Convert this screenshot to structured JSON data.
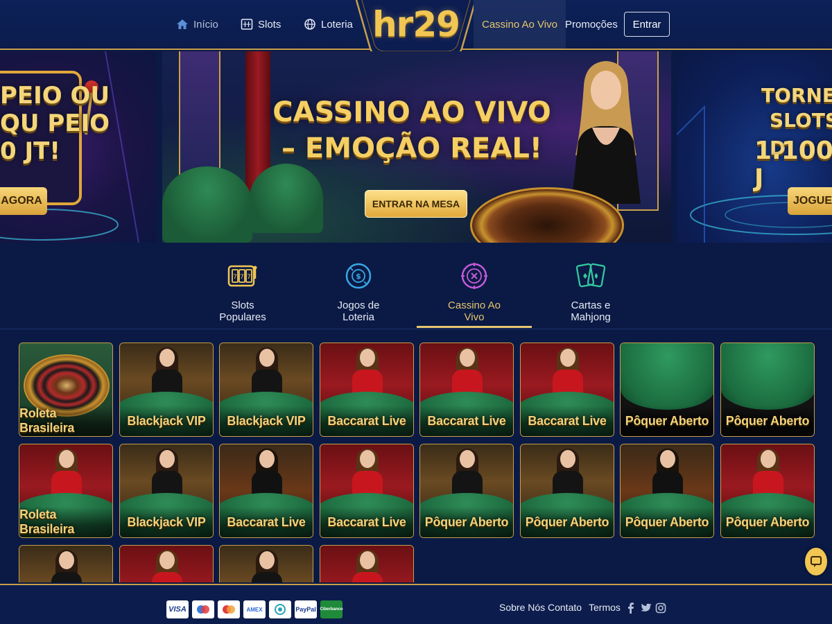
{
  "header": {
    "nav": [
      {
        "label": "Início",
        "icon": "home-icon"
      },
      {
        "label": "Slots",
        "icon": "slot-machine-icon"
      },
      {
        "label": "Loteria",
        "icon": "globe-icon"
      },
      {
        "label": "Cassino Ao Vivo",
        "icon": ""
      },
      {
        "label": "Promoções",
        "icon": ""
      }
    ],
    "logo": "hr29",
    "login_label": "Entrar"
  },
  "hero": {
    "left_slide": {
      "title_lines": [
        "PEIO OU",
        "QU PEIO",
        "0 JT!"
      ],
      "button": "AGORA"
    },
    "main_slide": {
      "title": "CASSINO AO VIVO – EMOÇÃO REAL!",
      "button": "ENTRAR NA MESA"
    },
    "right_slide": {
      "title_lines": [
        "TORNEIO",
        "SLOTS D",
        "1.100 J"
      ],
      "button": "JOGUE"
    },
    "active_dot": 0,
    "dot_count": 5
  },
  "categories": [
    {
      "label": "Slots Populares",
      "icon": "slot-reels-icon",
      "color": "#f1c653"
    },
    {
      "label": "Jogos de Loteria",
      "icon": "lottery-ball-icon",
      "color": "#3aa8e6"
    },
    {
      "label": "Cassino Ao Vivo",
      "icon": "roulette-chip-icon",
      "color": "#c45bd6",
      "active": true
    },
    {
      "label": "Cartas e Mahjong",
      "icon": "playing-cards-icon",
      "color": "#35c8a0"
    }
  ],
  "games": [
    {
      "name": "Roleta Brasileira",
      "kind": "roulette"
    },
    {
      "name": "Blackjack VIP",
      "kind": "blackjack"
    },
    {
      "name": "Blackjack VIP",
      "kind": "blackjack"
    },
    {
      "name": "Baccarat Live",
      "kind": "baccarat"
    },
    {
      "name": "Baccarat Live",
      "kind": "baccarat"
    },
    {
      "name": "Baccarat Live",
      "kind": "baccarat"
    },
    {
      "name": "Pôquer Aberto",
      "kind": "poker"
    },
    {
      "name": "Pôquer Aberto",
      "kind": "poker"
    },
    {
      "name": "Roleta Brasileira",
      "kind": "baccarat"
    },
    {
      "name": "Blackjack VIP",
      "kind": "blackjack"
    },
    {
      "name": "Baccarat Live",
      "kind": "male"
    },
    {
      "name": "Baccarat Live",
      "kind": "baccarat"
    },
    {
      "name": "Pôquer Aberto",
      "kind": "blackjack"
    },
    {
      "name": "Pôquer Aberto",
      "kind": "blackjack"
    },
    {
      "name": "Pôquer Aberto",
      "kind": "male"
    },
    {
      "name": "Pôquer Aberto",
      "kind": "baccarat"
    },
    {
      "name": "",
      "kind": "blackjack"
    },
    {
      "name": "",
      "kind": "baccarat"
    },
    {
      "name": "",
      "kind": "blackjack"
    },
    {
      "name": "",
      "kind": "baccarat"
    }
  ],
  "footer": {
    "payments": [
      "VISA",
      "maestro",
      "mastercard",
      "AMEX",
      "PIX",
      "PayPal",
      "Ciberbanco"
    ],
    "links": [
      "Sobre Nós",
      "Contato",
      "Termos"
    ],
    "social": [
      "facebook-icon",
      "twitter-icon",
      "instagram-icon"
    ]
  },
  "colors": {
    "gold": "#f1c653",
    "bg": "#0a1a45",
    "accent": "#e7c66e"
  }
}
